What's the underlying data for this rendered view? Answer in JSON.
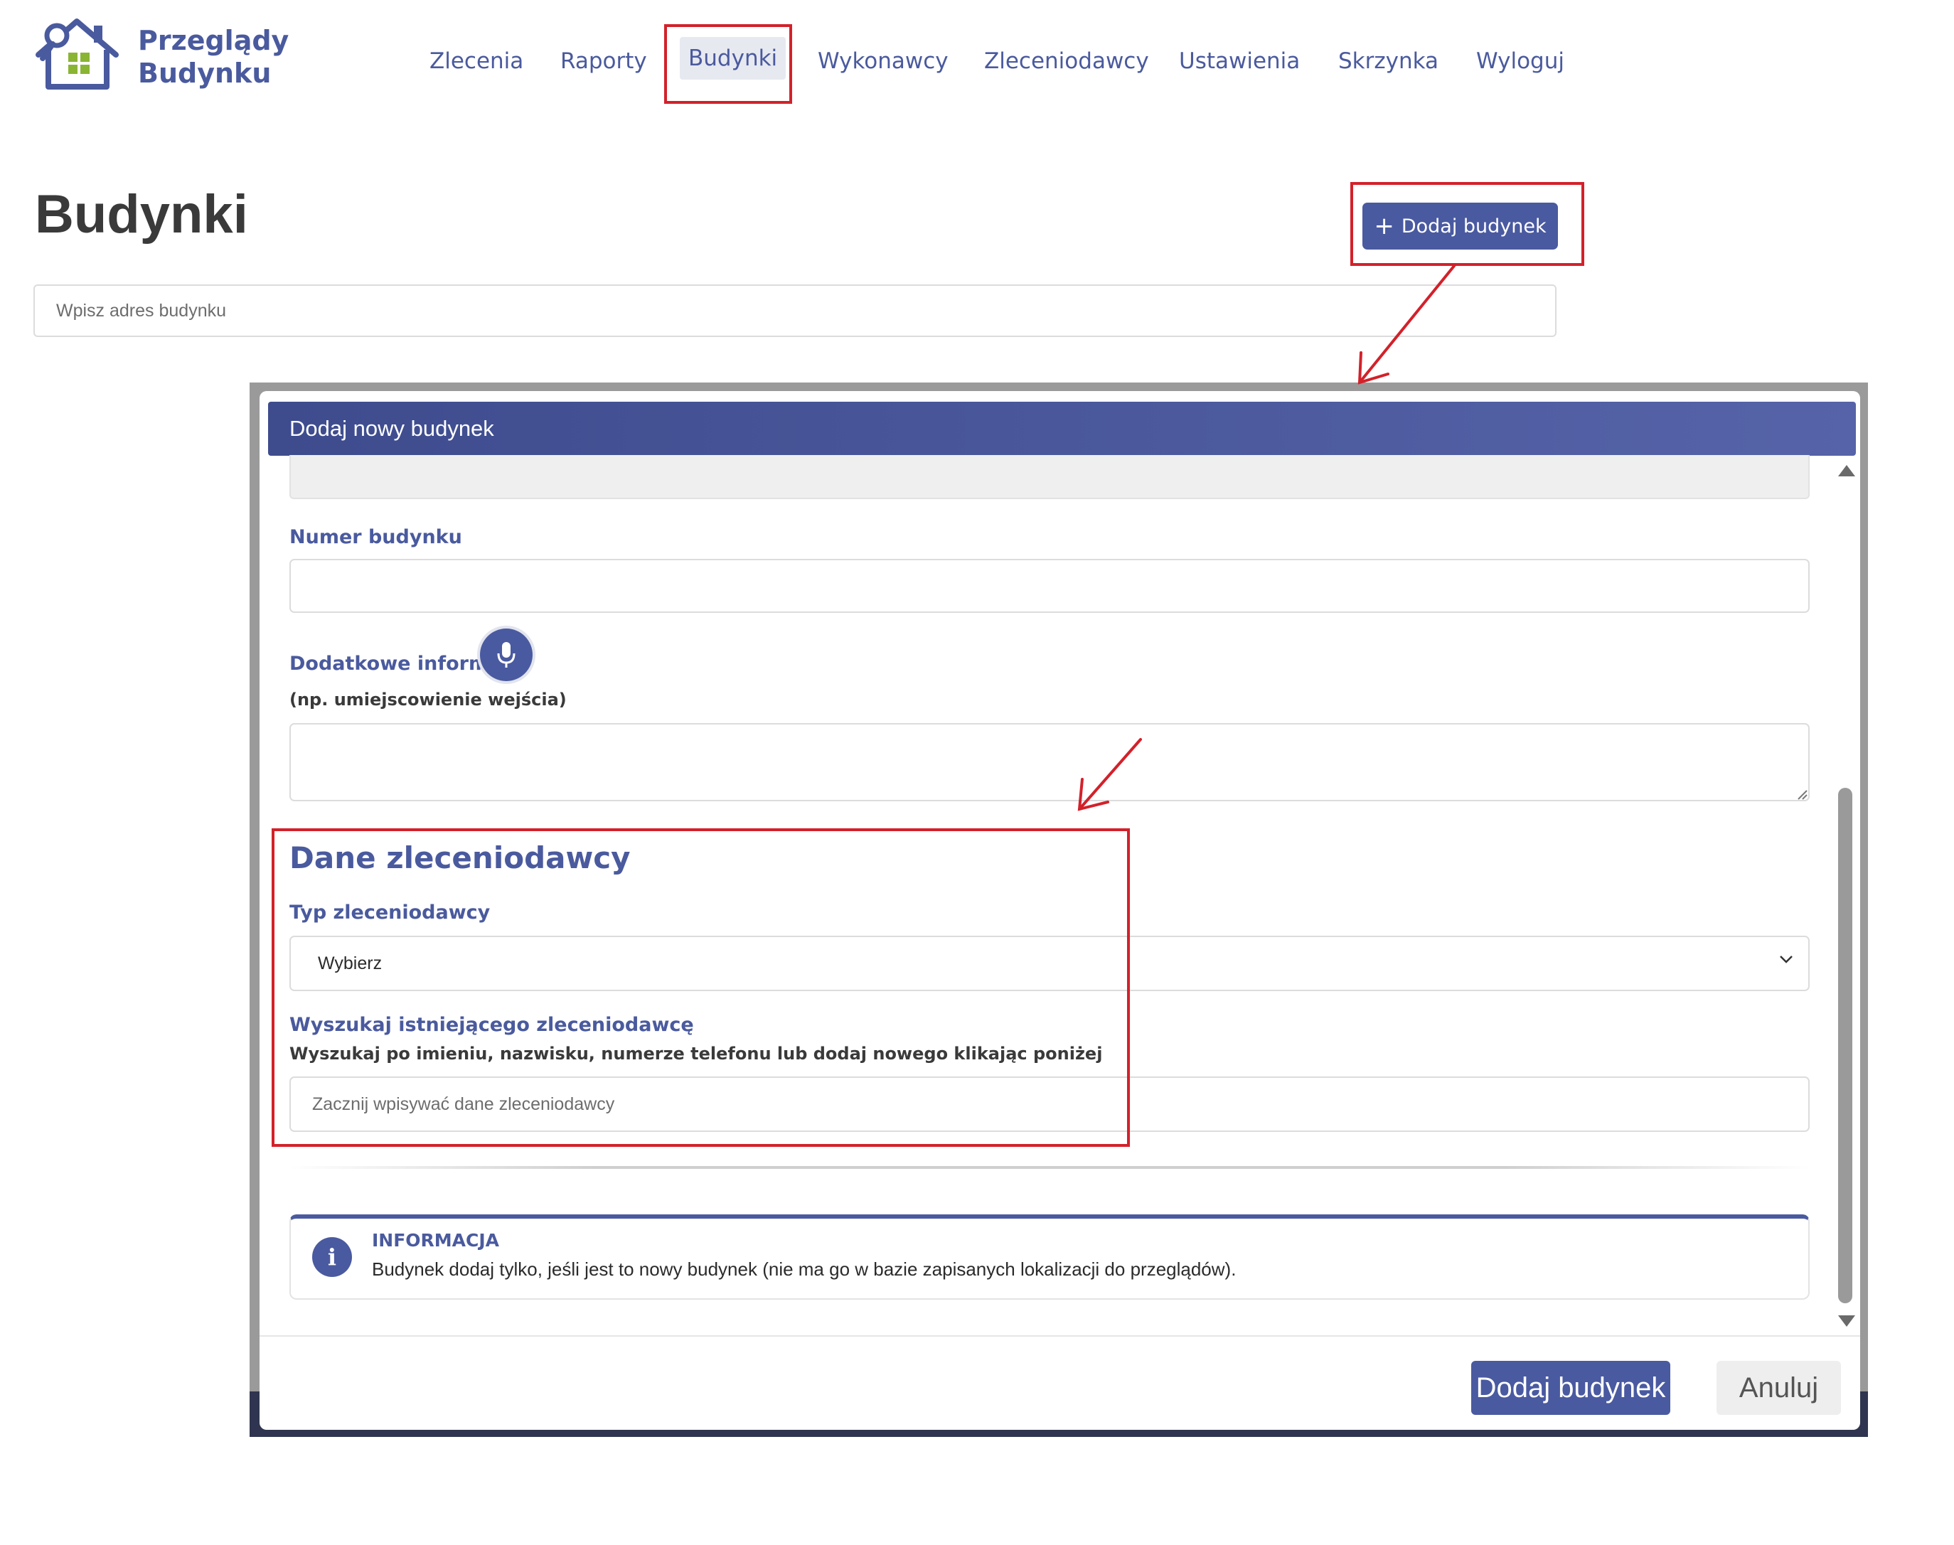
{
  "brand": {
    "line1": "Przeglądy",
    "line2": "Budynku"
  },
  "nav": {
    "items": [
      "Zlecenia",
      "Raporty",
      "Budynki",
      "Wykonawcy",
      "Zleceniodawcy",
      "Ustawienia",
      "Skrzynka",
      "Wyloguj"
    ],
    "active": "Budynki"
  },
  "page": {
    "title": "Budynki",
    "add_button": "Dodaj budynek",
    "search_placeholder": "Wpisz adres budynku"
  },
  "modal": {
    "title": "Dodaj nowy budynek",
    "building_number_label": "Numer budynku",
    "building_number_value": "",
    "extra_info_label": "Dodatkowe informacje",
    "extra_info_hint": "(np. umiejscowienie wejścia)",
    "extra_info_value": "",
    "client_section_title": "Dane zleceniodawcy",
    "client_type_label": "Typ zleceniodawcy",
    "client_type_value": "Wybierz",
    "search_client_label": "Wyszukaj istniejącego zleceniodawcę",
    "search_client_hint": "Wyszukaj po imieniu, nazwisku, numerze telefonu lub dodaj nowego klikając poniżej",
    "search_client_placeholder": "Zacznij wpisywać dane zleceniodawcy",
    "info_title": "INFORMACJA",
    "info_text": "Budynek dodaj tylko, jeśli jest to nowy budynek (nie ma go w bazie zapisanych lokalizacji do przeglądów).",
    "submit_button": "Dodaj budynek",
    "cancel_button": "Anuluj"
  },
  "colors": {
    "accent": "#4a5aa0",
    "annotation": "#d3212a",
    "logo_green": "#8ab534"
  },
  "icons": [
    "house-logo-icon",
    "plus-icon",
    "microphone-icon",
    "chevron-down-icon",
    "info-icon",
    "resize-handle-icon"
  ]
}
